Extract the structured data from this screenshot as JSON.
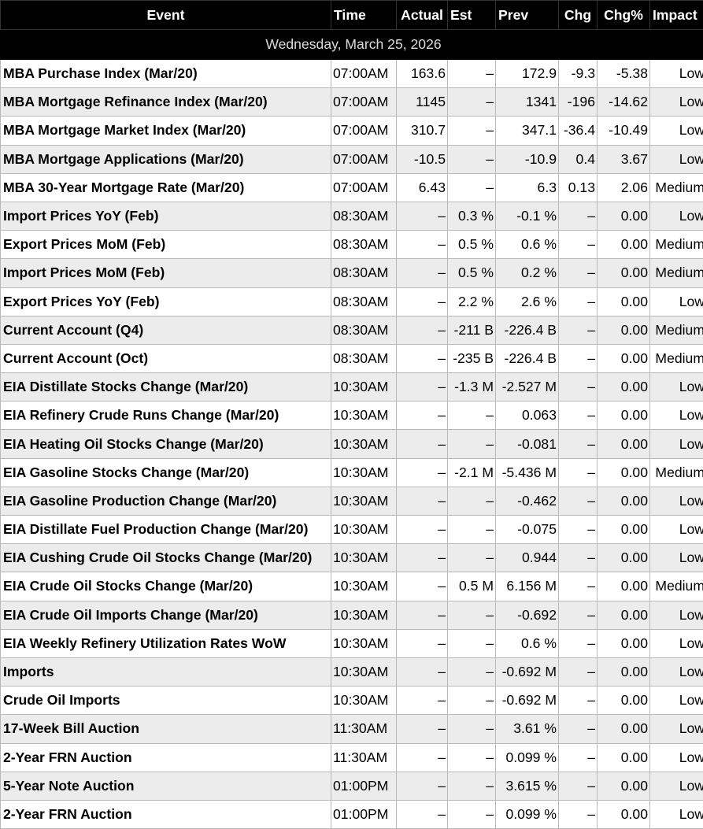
{
  "headers": {
    "event": "Event",
    "time": "Time",
    "actual": "Actual",
    "est": "Est",
    "prev": "Prev",
    "chg": "Chg",
    "chg_pct": "Chg%",
    "impact": "Impact"
  },
  "date_label": "Wednesday, March 25, 2026",
  "rows": [
    {
      "event": "MBA Purchase Index (Mar/20)",
      "time": "07:00AM",
      "actual": "163.6",
      "est": "–",
      "prev": "172.9",
      "chg": "-9.3",
      "chg_pct": "-5.38",
      "impact": "Low"
    },
    {
      "event": "MBA Mortgage Refinance Index (Mar/20)",
      "time": "07:00AM",
      "actual": "1145",
      "est": "–",
      "prev": "1341",
      "chg": "-196",
      "chg_pct": "-14.62",
      "impact": "Low"
    },
    {
      "event": "MBA Mortgage Market Index (Mar/20)",
      "time": "07:00AM",
      "actual": "310.7",
      "est": "–",
      "prev": "347.1",
      "chg": "-36.4",
      "chg_pct": "-10.49",
      "impact": "Low"
    },
    {
      "event": "MBA Mortgage Applications (Mar/20)",
      "time": "07:00AM",
      "actual": "-10.5",
      "est": "–",
      "prev": "-10.9",
      "chg": "0.4",
      "chg_pct": "3.67",
      "impact": "Low"
    },
    {
      "event": "MBA 30-Year Mortgage Rate (Mar/20)",
      "time": "07:00AM",
      "actual": "6.43",
      "est": "–",
      "prev": "6.3",
      "chg": "0.13",
      "chg_pct": "2.06",
      "impact": "Medium"
    },
    {
      "event": "Import Prices YoY (Feb)",
      "time": "08:30AM",
      "actual": "–",
      "est": "0.3 %",
      "prev": "-0.1 %",
      "chg": "–",
      "chg_pct": "0.00",
      "impact": "Low"
    },
    {
      "event": "Export Prices MoM (Feb)",
      "time": "08:30AM",
      "actual": "–",
      "est": "0.5 %",
      "prev": "0.6 %",
      "chg": "–",
      "chg_pct": "0.00",
      "impact": "Medium"
    },
    {
      "event": "Import Prices MoM (Feb)",
      "time": "08:30AM",
      "actual": "–",
      "est": "0.5 %",
      "prev": "0.2 %",
      "chg": "–",
      "chg_pct": "0.00",
      "impact": "Medium"
    },
    {
      "event": "Export Prices YoY (Feb)",
      "time": "08:30AM",
      "actual": "–",
      "est": "2.2 %",
      "prev": "2.6 %",
      "chg": "–",
      "chg_pct": "0.00",
      "impact": "Low"
    },
    {
      "event": "Current Account (Q4)",
      "time": "08:30AM",
      "actual": "–",
      "est": "-211 B",
      "prev": "-226.4 B",
      "chg": "–",
      "chg_pct": "0.00",
      "impact": "Medium"
    },
    {
      "event": "Current Account (Oct)",
      "time": "08:30AM",
      "actual": "–",
      "est": "-235 B",
      "prev": "-226.4 B",
      "chg": "–",
      "chg_pct": "0.00",
      "impact": "Medium"
    },
    {
      "event": "EIA Distillate Stocks Change (Mar/20)",
      "time": "10:30AM",
      "actual": "–",
      "est": "-1.3 M",
      "prev": "-2.527 M",
      "chg": "–",
      "chg_pct": "0.00",
      "impact": "Low"
    },
    {
      "event": "EIA Refinery Crude Runs Change (Mar/20)",
      "time": "10:30AM",
      "actual": "–",
      "est": "–",
      "prev": "0.063",
      "chg": "–",
      "chg_pct": "0.00",
      "impact": "Low"
    },
    {
      "event": "EIA Heating Oil Stocks Change (Mar/20)",
      "time": "10:30AM",
      "actual": "–",
      "est": "–",
      "prev": "-0.081",
      "chg": "–",
      "chg_pct": "0.00",
      "impact": "Low"
    },
    {
      "event": "EIA Gasoline Stocks Change (Mar/20)",
      "time": "10:30AM",
      "actual": "–",
      "est": "-2.1 M",
      "prev": "-5.436 M",
      "chg": "–",
      "chg_pct": "0.00",
      "impact": "Medium"
    },
    {
      "event": "EIA Gasoline Production Change (Mar/20)",
      "time": "10:30AM",
      "actual": "–",
      "est": "–",
      "prev": "-0.462",
      "chg": "–",
      "chg_pct": "0.00",
      "impact": "Low"
    },
    {
      "event": "EIA Distillate Fuel Production Change (Mar/20)",
      "time": "10:30AM",
      "actual": "–",
      "est": "–",
      "prev": "-0.075",
      "chg": "–",
      "chg_pct": "0.00",
      "impact": "Low"
    },
    {
      "event": "EIA Cushing Crude Oil Stocks Change (Mar/20)",
      "time": "10:30AM",
      "actual": "–",
      "est": "–",
      "prev": "0.944",
      "chg": "–",
      "chg_pct": "0.00",
      "impact": "Low"
    },
    {
      "event": "EIA Crude Oil Stocks Change (Mar/20)",
      "time": "10:30AM",
      "actual": "–",
      "est": "0.5 M",
      "prev": "6.156 M",
      "chg": "–",
      "chg_pct": "0.00",
      "impact": "Medium"
    },
    {
      "event": "EIA Crude Oil Imports Change (Mar/20)",
      "time": "10:30AM",
      "actual": "–",
      "est": "–",
      "prev": "-0.692",
      "chg": "–",
      "chg_pct": "0.00",
      "impact": "Low"
    },
    {
      "event": "EIA Weekly Refinery Utilization Rates WoW",
      "time": "10:30AM",
      "actual": "–",
      "est": "–",
      "prev": "0.6 %",
      "chg": "–",
      "chg_pct": "0.00",
      "impact": "Low"
    },
    {
      "event": "Imports",
      "time": "10:30AM",
      "actual": "–",
      "est": "–",
      "prev": "-0.692 M",
      "chg": "–",
      "chg_pct": "0.00",
      "impact": "Low"
    },
    {
      "event": "Crude Oil Imports",
      "time": "10:30AM",
      "actual": "–",
      "est": "–",
      "prev": "-0.692 M",
      "chg": "–",
      "chg_pct": "0.00",
      "impact": "Low"
    },
    {
      "event": "17-Week Bill Auction",
      "time": "11:30AM",
      "actual": "–",
      "est": "–",
      "prev": "3.61 %",
      "chg": "–",
      "chg_pct": "0.00",
      "impact": "Low"
    },
    {
      "event": "2-Year FRN Auction",
      "time": "11:30AM",
      "actual": "–",
      "est": "–",
      "prev": "0.099 %",
      "chg": "–",
      "chg_pct": "0.00",
      "impact": "Low"
    },
    {
      "event": "5-Year Note Auction",
      "time": "01:00PM",
      "actual": "–",
      "est": "–",
      "prev": "3.615 %",
      "chg": "–",
      "chg_pct": "0.00",
      "impact": "Low"
    },
    {
      "event": "2-Year FRN Auction",
      "time": "01:00PM",
      "actual": "–",
      "est": "–",
      "prev": "0.099 %",
      "chg": "–",
      "chg_pct": "0.00",
      "impact": "Low"
    }
  ]
}
